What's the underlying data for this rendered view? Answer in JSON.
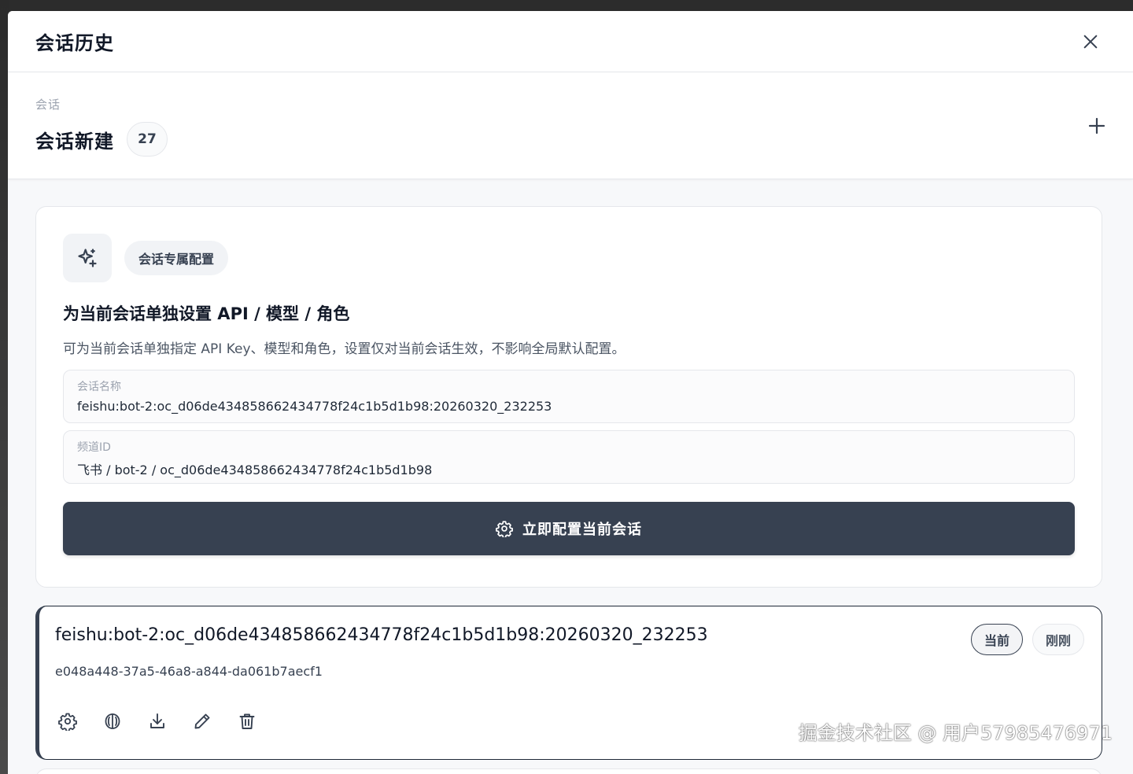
{
  "header": {
    "title": "会话历史"
  },
  "section": {
    "eyebrow": "会话",
    "title": "会话新建",
    "count": "27"
  },
  "config_card": {
    "pill_label": "会话专属配置",
    "heading": "为当前会话单独设置 API / 模型 / 角色",
    "description": "可为当前会话单独指定 API Key、模型和角色，设置仅对当前会话生效，不影响全局默认配置。",
    "fields": [
      {
        "label": "会话名称",
        "value": "feishu:bot-2:oc_d06de434858662434778f24c1b5d1b98:20260320_232253"
      },
      {
        "label": "频道ID",
        "value": "飞书 / bot-2 / oc_d06de434858662434778f24c1b5d1b98"
      }
    ],
    "button_label": "立即配置当前会话"
  },
  "session": {
    "title": "feishu:bot-2:oc_d06de434858662434778f24c1b5d1b98:20260320_232253",
    "id": "e048a448-37a5-46a8-a844-da061b7aecf1",
    "tag_current": "当前",
    "tag_time": "刚刚"
  },
  "watermark": "掘金技术社区 @ 用户57985476971",
  "icons": {
    "close": "close-icon",
    "add": "plus-icon",
    "sparkle": "sparkle-icon",
    "settings": "gear-icon",
    "brain": "brain-icon",
    "download": "download-icon",
    "edit": "pencil-icon",
    "delete": "trash-icon"
  },
  "colors": {
    "primary": "#374151",
    "background": "#f7f8fa",
    "border": "#e5e7eb"
  }
}
